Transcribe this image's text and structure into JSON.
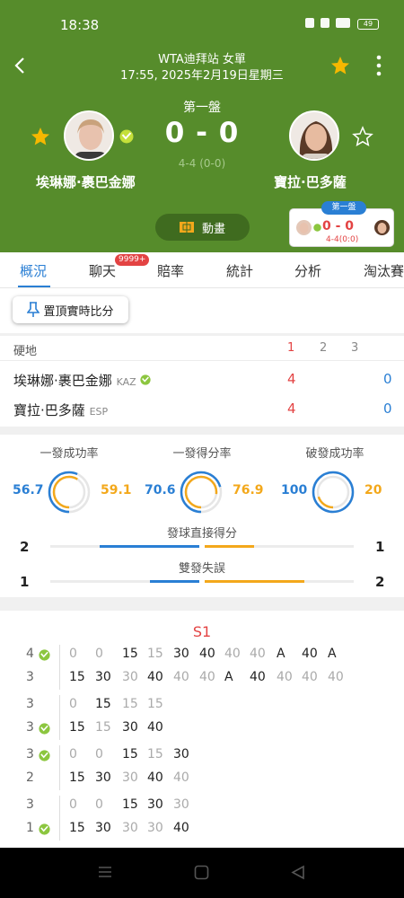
{
  "status": {
    "time": "18:38",
    "battery": "49"
  },
  "header": {
    "title1": "WTA迪拜站 女單",
    "title2": "17:55, 2025年2月19日星期三",
    "set_label": "第一盤",
    "score": "0 - 0",
    "sub_score": "4-4 (0-0)",
    "anim_label": "動畫",
    "p1_name": "埃琳娜·裹巴金娜",
    "p2_name": "寶拉·巴多薩",
    "mini": {
      "tag": "第一盤",
      "score": "0 - 0",
      "sub": "4-4(0:0)"
    }
  },
  "tabs": {
    "items": [
      "概況",
      "聊天",
      "賠率",
      "統計",
      "分析",
      "淘汰賽"
    ],
    "badge": "9999+"
  },
  "pin_label": "置頂實時比分",
  "scorecard": {
    "surface": "硬地",
    "set_headers": [
      "1",
      "2",
      "3"
    ],
    "players": [
      {
        "name": "埃琳娜·裹巴金娜",
        "country": "KAZ",
        "set1": "4",
        "total": "0"
      },
      {
        "name": "寶拉·巴多薩",
        "country": "ESP",
        "set1": "4",
        "total": "0"
      }
    ]
  },
  "stats": {
    "rings": [
      {
        "title": "一發成功率",
        "left": "56.7",
        "right": "59.1",
        "left_val": 56.7,
        "right_val": 59.1
      },
      {
        "title": "一發得分率",
        "left": "70.6",
        "right": "76.9",
        "left_val": 70.6,
        "right_val": 76.9
      },
      {
        "title": "破發成功率",
        "left": "100",
        "right": "20",
        "left_val": 100,
        "right_val": 20
      }
    ],
    "bars": [
      {
        "title": "發球直接得分",
        "left": "2",
        "right": "1",
        "left_val": 2,
        "right_val": 1
      },
      {
        "title": "雙發失誤",
        "left": "1",
        "right": "2",
        "left_val": 1,
        "right_val": 2
      }
    ]
  },
  "pbp": {
    "set_label": "S1",
    "games": [
      {
        "top": {
          "score": "4",
          "serve": true,
          "points": [
            "0",
            "0",
            "15",
            "15",
            "30",
            "40",
            "40",
            "40",
            "A",
            "40",
            "A"
          ]
        },
        "bot": {
          "score": "3",
          "serve": false,
          "points": [
            "15",
            "30",
            "30",
            "40",
            "40",
            "40",
            "A",
            "40",
            "40",
            "40",
            "40"
          ]
        }
      },
      {
        "top": {
          "score": "3",
          "serve": false,
          "points": [
            "0",
            "15",
            "15",
            "15"
          ]
        },
        "bot": {
          "score": "3",
          "serve": true,
          "points": [
            "15",
            "15",
            "30",
            "40"
          ]
        }
      },
      {
        "top": {
          "score": "3",
          "serve": true,
          "points": [
            "0",
            "0",
            "15",
            "15",
            "30"
          ]
        },
        "bot": {
          "score": "2",
          "serve": false,
          "points": [
            "15",
            "30",
            "30",
            "40",
            "40"
          ]
        }
      },
      {
        "top": {
          "score": "3",
          "serve": false,
          "points": [
            "0",
            "0",
            "15",
            "30",
            "30"
          ]
        },
        "bot": {
          "score": "1",
          "serve": true,
          "points": [
            "15",
            "30",
            "30",
            "30",
            "40"
          ]
        }
      }
    ]
  },
  "colors": {
    "green": "#568c2b",
    "blue": "#2a7fd4",
    "orange": "#f3a81b",
    "red": "#e34343"
  }
}
